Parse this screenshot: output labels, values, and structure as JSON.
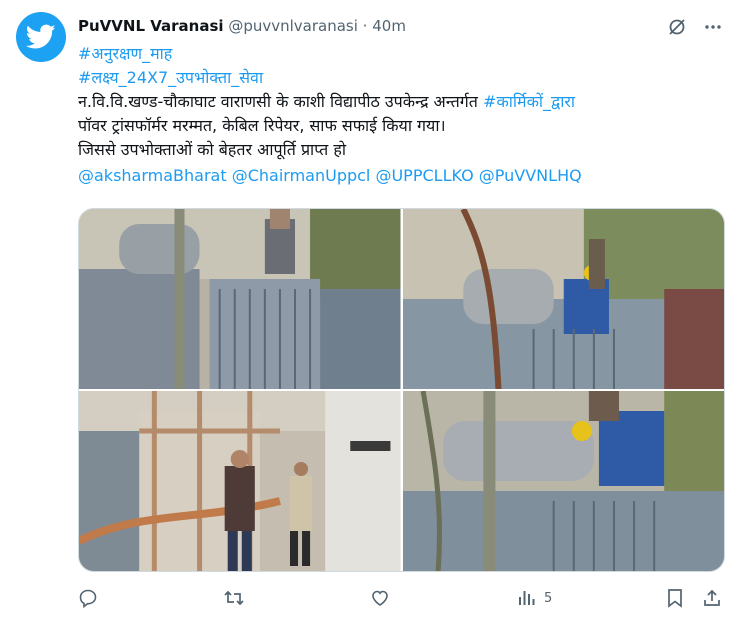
{
  "author": {
    "name": "PuVVNL Varanasi",
    "handle": "@puvvnlvaranasi",
    "separator": "·",
    "time": "40m"
  },
  "tweet": {
    "hashtag1": "#अनुरक्षण_माह",
    "hashtag2": "#लक्ष्य_24X7_उपभोक्ता_सेवा",
    "line3_text": "न.वि.वि.खण्ड-चौकाघाट वाराणसी के काशी विद्यापीठ उपकेन्द्र अन्तर्गत ",
    "line3_hashtag": "#कार्मिकों_द्वारा",
    "line4": "पॉवर ट्रांसफॉर्मर मरम्मत, केबिल रिपेयर, साफ सफाई किया गया।",
    "line5": "जिससे उपभोक्ताओं को बेहतर आपूर्ति प्राप्त हो",
    "mention1": "@aksharmaBharat",
    "mention2": "@ChairmanUppcl",
    "mention3": "@UPPCLLKO",
    "mention4": "@PuVVNLHQ"
  },
  "actions": {
    "views_count": "5"
  },
  "colors": {
    "link": "#1d9bf0",
    "muted": "#536471",
    "brand": "#1da1f2"
  },
  "icons": [
    "twitter-bird-icon",
    "grok-icon",
    "more-icon",
    "reply-icon",
    "retweet-icon",
    "like-icon",
    "views-icon",
    "bookmark-icon",
    "share-icon"
  ]
}
